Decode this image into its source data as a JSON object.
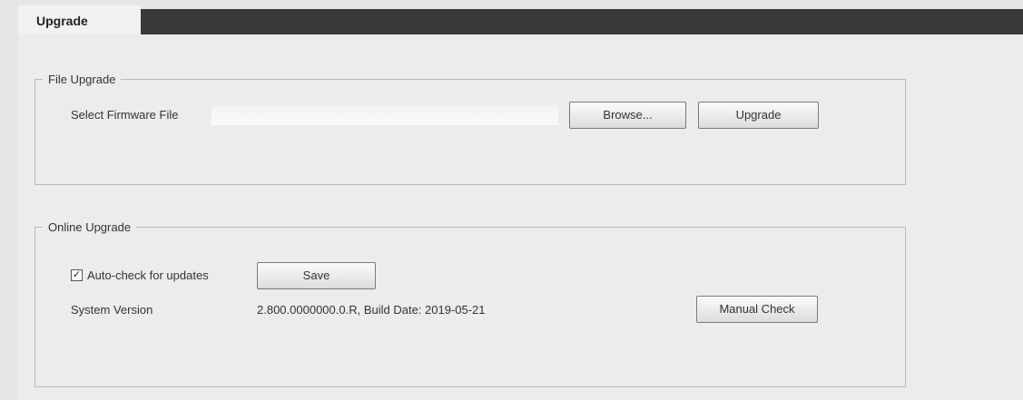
{
  "tabs": {
    "active": "Upgrade"
  },
  "file_upgrade": {
    "title": "File Upgrade",
    "select_label": "Select Firmware File",
    "file_value": "",
    "browse_label": "Browse...",
    "upgrade_label": "Upgrade"
  },
  "online_upgrade": {
    "title": "Online Upgrade",
    "auto_check_label": "Auto-check for updates",
    "auto_check_checked": true,
    "checkmark": "✓",
    "save_label": "Save",
    "system_version_label": "System Version",
    "system_version_value": "2.800.0000000.0.R, Build Date: 2019-05-21",
    "manual_check_label": "Manual Check"
  }
}
